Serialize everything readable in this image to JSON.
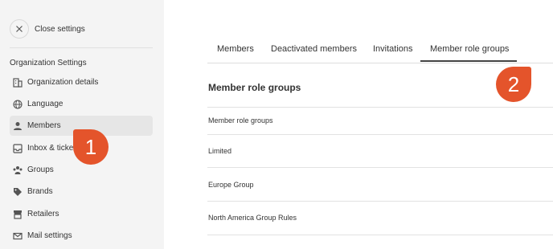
{
  "sidebar": {
    "close_label": "Close settings",
    "section_title": "Organization Settings",
    "items": [
      {
        "label": "Organization details",
        "icon": "building-icon"
      },
      {
        "label": "Language",
        "icon": "globe-icon"
      },
      {
        "label": "Members",
        "icon": "person-icon",
        "active": true
      },
      {
        "label": "Inbox & tickets",
        "icon": "inbox-icon"
      },
      {
        "label": "Groups",
        "icon": "groups-icon"
      },
      {
        "label": "Brands",
        "icon": "tag-icon"
      },
      {
        "label": "Retailers",
        "icon": "store-icon"
      },
      {
        "label": "Mail settings",
        "icon": "mail-icon"
      }
    ]
  },
  "tabs": [
    {
      "label": "Members"
    },
    {
      "label": "Deactivated members"
    },
    {
      "label": "Invitations"
    },
    {
      "label": "Member role groups",
      "active": true
    }
  ],
  "main": {
    "section_title": "Member role groups",
    "rows": [
      "Member role groups",
      "Limited",
      "Europe Group",
      "North America Group Rules"
    ]
  },
  "annotations": {
    "badge1": "1",
    "badge2": "2"
  },
  "colors": {
    "sidebar_bg": "#f4f4f4",
    "badge": "#e4542b",
    "active_tab_underline": "#444444"
  }
}
